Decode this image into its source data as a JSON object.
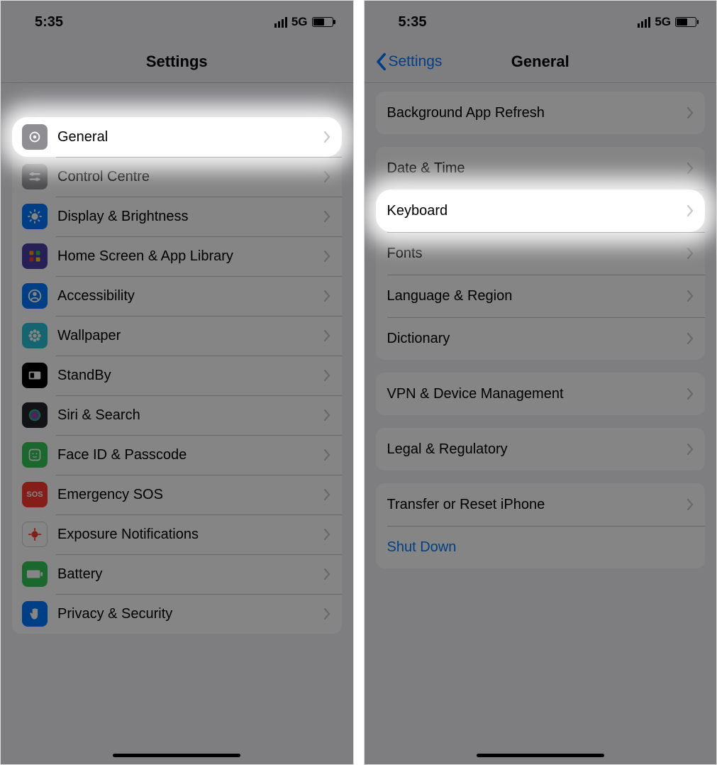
{
  "status": {
    "time": "5:35",
    "network": "5G"
  },
  "left": {
    "title": "Settings",
    "items": [
      {
        "name": "general",
        "label": "General",
        "iconColor": "#8e8e93",
        "glyph": "gear",
        "highlight": true
      },
      {
        "name": "control-centre",
        "label": "Control Centre",
        "iconColor": "#8e8e93",
        "glyph": "sliders"
      },
      {
        "name": "display-brightness",
        "label": "Display & Brightness",
        "iconColor": "#007aff",
        "glyph": "sun"
      },
      {
        "name": "home-screen-app-library",
        "label": "Home Screen & App Library",
        "iconColor": "#4b3fa5",
        "glyph": "grid"
      },
      {
        "name": "accessibility",
        "label": "Accessibility",
        "iconColor": "#007aff",
        "glyph": "person"
      },
      {
        "name": "wallpaper",
        "label": "Wallpaper",
        "iconColor": "#29c2d6",
        "glyph": "flower"
      },
      {
        "name": "standby",
        "label": "StandBy",
        "iconColor": "#000000",
        "glyph": "clock"
      },
      {
        "name": "siri-search",
        "label": "Siri & Search",
        "iconColor": "#26252c",
        "glyph": "siri"
      },
      {
        "name": "face-id-passcode",
        "label": "Face ID & Passcode",
        "iconColor": "#34c759",
        "glyph": "face"
      },
      {
        "name": "emergency-sos",
        "label": "Emergency SOS",
        "iconColor": "#ff3b30",
        "glyph": "sos",
        "glyphText": "SOS"
      },
      {
        "name": "exposure-notifications",
        "label": "Exposure Notifications",
        "iconColor": "#ffffff",
        "glyph": "virus",
        "glyphColor": "#ff3b30",
        "border": true
      },
      {
        "name": "battery",
        "label": "Battery",
        "iconColor": "#34c759",
        "glyph": "battery"
      },
      {
        "name": "privacy-security",
        "label": "Privacy & Security",
        "iconColor": "#007aff",
        "glyph": "hand"
      }
    ]
  },
  "right": {
    "back": "Settings",
    "title": "General",
    "groups": [
      {
        "items": [
          {
            "name": "background-app-refresh",
            "label": "Background App Refresh"
          }
        ]
      },
      {
        "items": [
          {
            "name": "date-time",
            "label": "Date & Time"
          },
          {
            "name": "keyboard",
            "label": "Keyboard",
            "highlight": true
          },
          {
            "name": "fonts",
            "label": "Fonts"
          },
          {
            "name": "language-region",
            "label": "Language & Region"
          },
          {
            "name": "dictionary",
            "label": "Dictionary"
          }
        ]
      },
      {
        "items": [
          {
            "name": "vpn-device-management",
            "label": "VPN & Device Management"
          }
        ]
      },
      {
        "items": [
          {
            "name": "legal-regulatory",
            "label": "Legal & Regulatory"
          }
        ]
      },
      {
        "items": [
          {
            "name": "transfer-reset",
            "label": "Transfer or Reset iPhone"
          },
          {
            "name": "shut-down",
            "label": "Shut Down",
            "link": true,
            "noChevron": true
          }
        ]
      }
    ]
  }
}
